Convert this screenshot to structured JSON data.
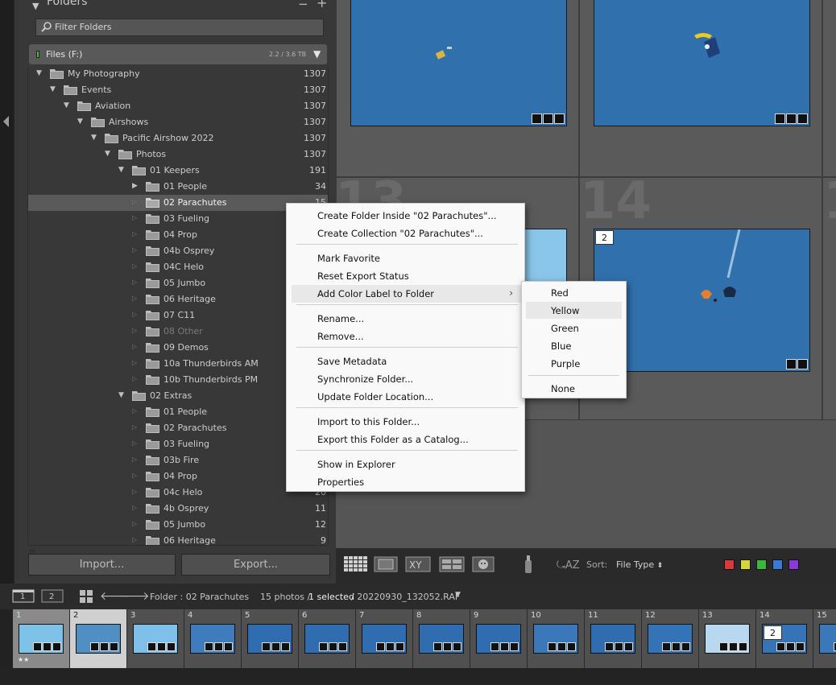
{
  "panel": {
    "title": "Folders",
    "minus": "−",
    "plus": "+",
    "filter_placeholder": "Filter Folders",
    "volume_name": "Files (F:)",
    "volume_size": "2.2 / 3.6 TB",
    "rows": [
      {
        "label": "My Photography",
        "count": "1307"
      },
      {
        "label": "Events",
        "count": "1307"
      },
      {
        "label": "Aviation",
        "count": "1307"
      },
      {
        "label": "Airshows",
        "count": "1307"
      },
      {
        "label": "Pacific Airshow 2022",
        "count": "1307"
      },
      {
        "label": "Photos",
        "count": "1307"
      },
      {
        "label": "01 Keepers",
        "count": "191"
      },
      {
        "label": "01 People",
        "count": "34",
        "color_label": "#4cb84c"
      },
      {
        "label": "02 Parachutes",
        "count": "15",
        "selected": true
      },
      {
        "label": "03 Fueling",
        "count": ""
      },
      {
        "label": "04 Prop",
        "count": ""
      },
      {
        "label": "04b Osprey",
        "count": ""
      },
      {
        "label": "04C Helo",
        "count": ""
      },
      {
        "label": "05 Jumbo",
        "count": ""
      },
      {
        "label": "06 Heritage",
        "count": ""
      },
      {
        "label": "07 C11",
        "count": ""
      },
      {
        "label": "08 Other",
        "count": "",
        "dim": true
      },
      {
        "label": "09 Demos",
        "count": ""
      },
      {
        "label": "10a Thunderbirds AM",
        "count": ""
      },
      {
        "label": "10b  Thunderbirds PM",
        "count": ""
      },
      {
        "label": "02 Extras",
        "count": ""
      },
      {
        "label": "01 People",
        "count": ""
      },
      {
        "label": "02 Parachutes",
        "count": ""
      },
      {
        "label": "03 Fueling",
        "count": ""
      },
      {
        "label": "03b Fire",
        "count": ""
      },
      {
        "label": "04 Prop",
        "count": ""
      },
      {
        "label": "04c Helo",
        "count": "20"
      },
      {
        "label": "4b Osprey",
        "count": "11"
      },
      {
        "label": "05 Jumbo",
        "count": "12"
      },
      {
        "label": "06 Heritage",
        "count": "9"
      }
    ],
    "import_label": "Import...",
    "export_label": "Export..."
  },
  "grid": {
    "cell_numbers": [
      "13",
      "14",
      "1"
    ],
    "stack_badge": "2"
  },
  "toolbar": {
    "sort_label": "Sort:",
    "sort_value": "File Type",
    "swatches": [
      "#d63a3a",
      "#d6d63a",
      "#3ab83a",
      "#3a7ad6",
      "#8a3ad6"
    ]
  },
  "filmstrip_bar": {
    "view1": "1",
    "view2": "2",
    "source": "Folder : 02 Parachutes",
    "count_text": "15 photos /",
    "selected_text": "1 selected",
    "filename": "/ 20220930_132052.RAF"
  },
  "filmstrip": {
    "numbers": [
      "1",
      "2",
      "3",
      "4",
      "5",
      "6",
      "7",
      "8",
      "9",
      "10",
      "11",
      "12",
      "13",
      "14",
      "15"
    ],
    "rating_1": "★★",
    "stack_14": "2"
  },
  "context_menu": {
    "items": [
      "Create Folder Inside \"02 Parachutes\"...",
      "Create Collection \"02 Parachutes\"...",
      "Mark Favorite",
      "Reset Export Status",
      "Add Color Label to Folder",
      "Rename...",
      "Remove...",
      "Save Metadata",
      "Synchronize Folder...",
      "Update Folder Location...",
      "Import to this Folder...",
      "Export this Folder as a Catalog...",
      "Show in Explorer",
      "Properties"
    ],
    "chevron": "›"
  },
  "color_submenu": {
    "items": [
      "Red",
      "Yellow",
      "Green",
      "Blue",
      "Purple",
      "None"
    ]
  }
}
